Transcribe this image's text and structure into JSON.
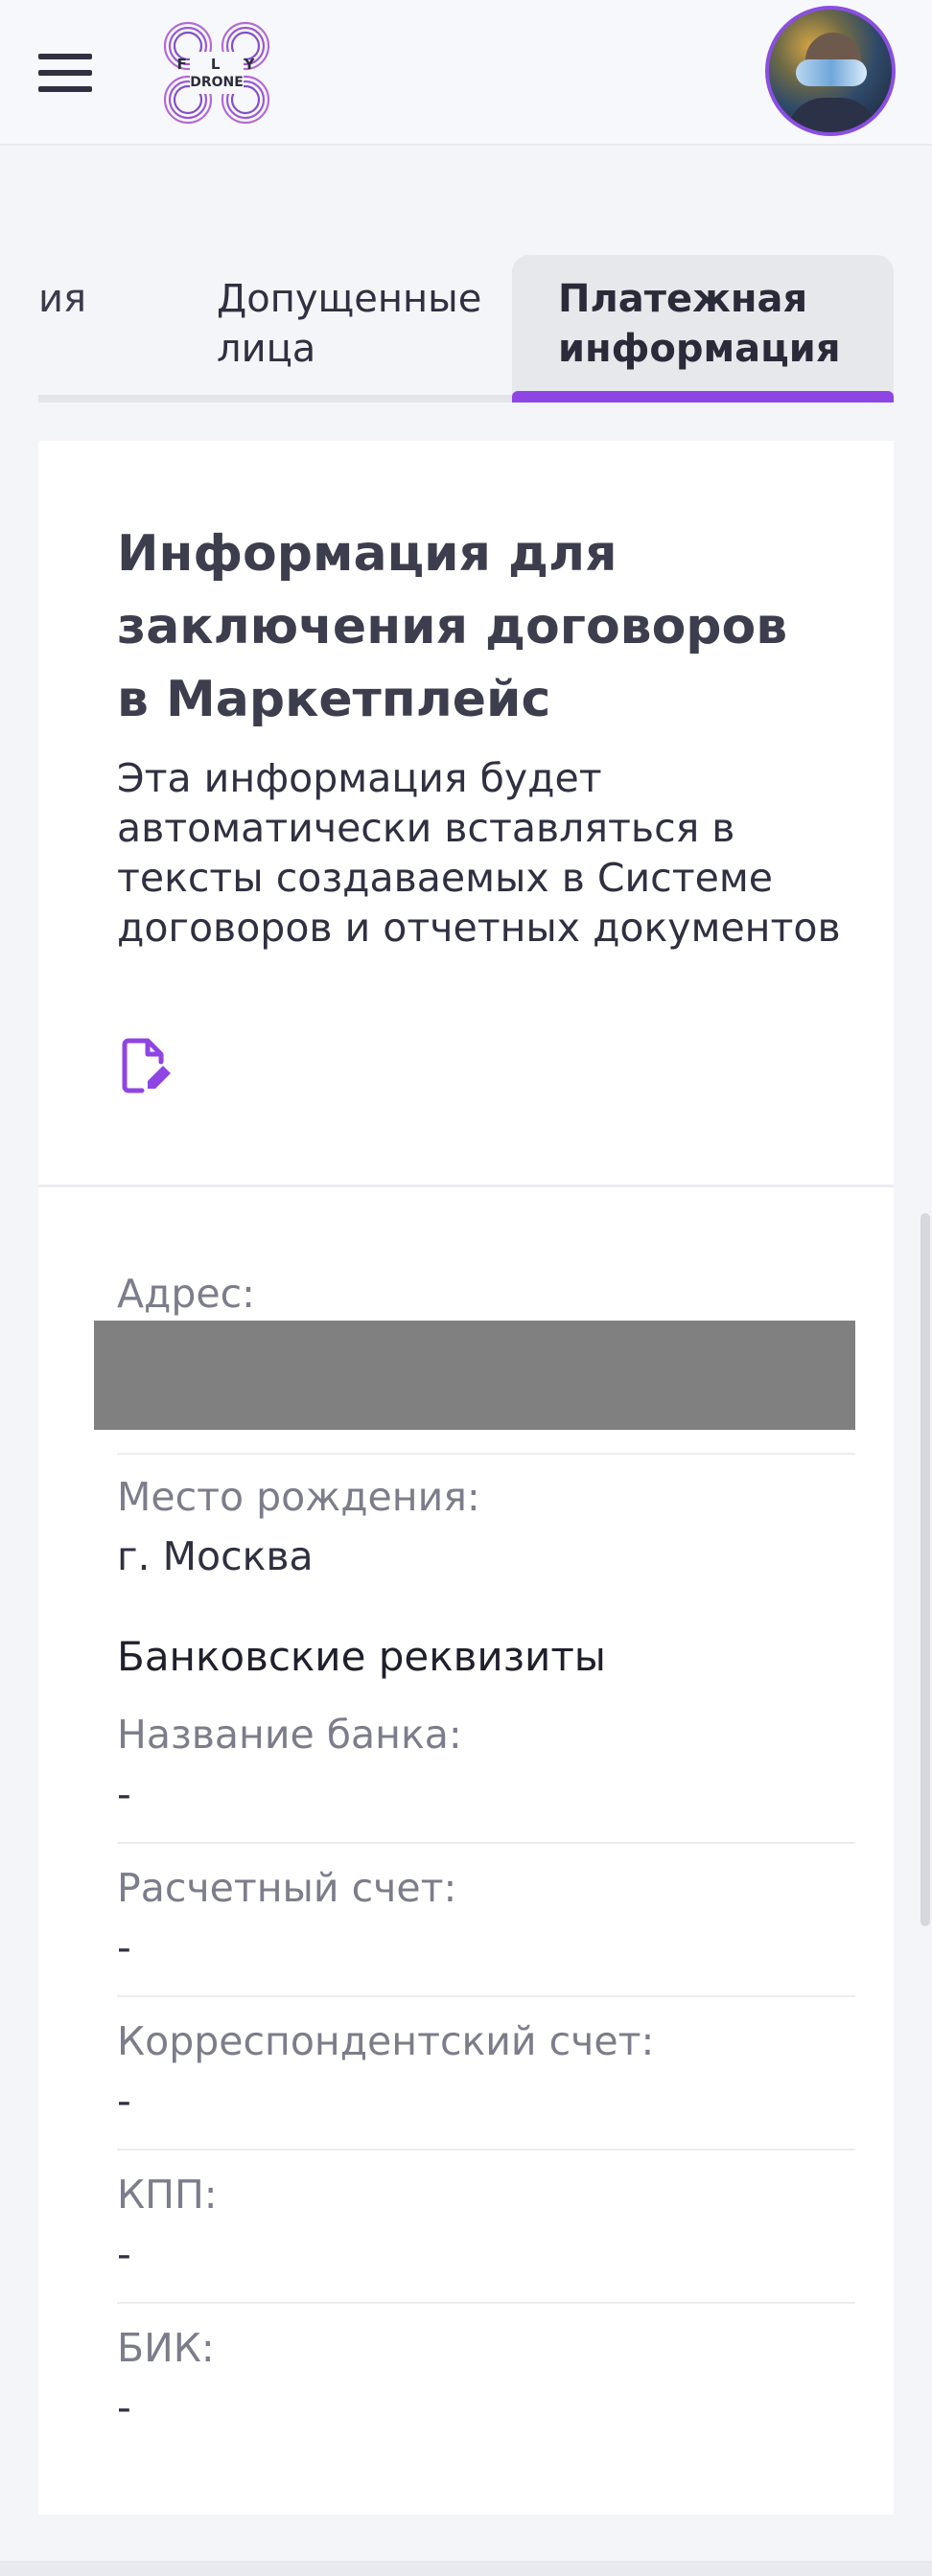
{
  "header": {
    "logo_line1": "F L Y",
    "logo_line2": "DRONE"
  },
  "tabs": [
    {
      "label": "ия"
    },
    {
      "label": "Допущенные\nлица"
    },
    {
      "label": "Платежная\nинформация",
      "active": true
    }
  ],
  "card": {
    "title": "Информация для заключения договоров в Маркетплейс",
    "description": "Эта информация будет автоматически вставляться в тексты создаваемых в Системе договоров и отчетных документов",
    "edit_icon": "edit-document-icon"
  },
  "fields": {
    "address_label": "Адрес:",
    "birthplace_label": "Место рождения:",
    "birthplace_value": "г. Москва"
  },
  "bank": {
    "section_title": "Банковские реквизиты",
    "items": [
      {
        "label": "Название банка:",
        "value": "-"
      },
      {
        "label": "Расчетный счет:",
        "value": "-"
      },
      {
        "label": "Корреспондентский счет:",
        "value": "-"
      },
      {
        "label": "КПП:",
        "value": "-"
      },
      {
        "label": "БИК:",
        "value": "-"
      }
    ]
  },
  "colors": {
    "accent": "#8f45e4",
    "background": "#f4f5f9",
    "card": "#ffffff",
    "label": "#7c7d8a",
    "redaction": "#808080"
  }
}
